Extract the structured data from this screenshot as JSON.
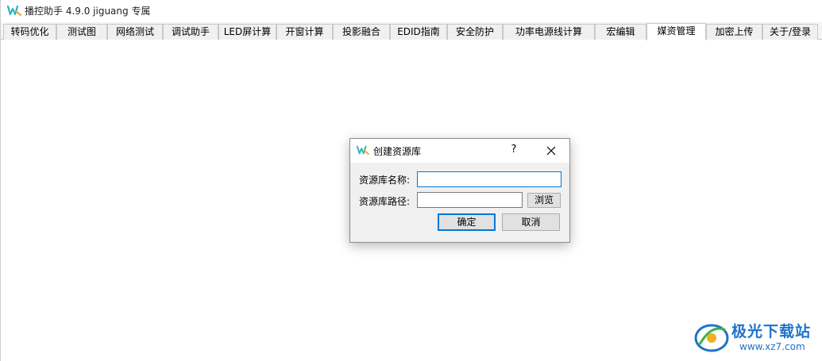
{
  "app": {
    "title": "播控助手 4.9.0  jiguang 专属",
    "logo_icon": "app-logo-icon",
    "accent_color": "#2bb3c0"
  },
  "tabs": [
    {
      "label": "转码优化",
      "active": false
    },
    {
      "label": "测试图",
      "active": false
    },
    {
      "label": "网络测试",
      "active": false
    },
    {
      "label": "调试助手",
      "active": false
    },
    {
      "label": "LED屏计算",
      "active": false
    },
    {
      "label": "开窗计算",
      "active": false
    },
    {
      "label": "投影融合",
      "active": false
    },
    {
      "label": "EDID指南",
      "active": false
    },
    {
      "label": "安全防护",
      "active": false
    },
    {
      "label": "功率电源线计算",
      "active": false
    },
    {
      "label": "宏编辑",
      "active": false
    },
    {
      "label": "媒资管理",
      "active": true
    },
    {
      "label": "加密上传",
      "active": false
    },
    {
      "label": "关于/登录",
      "active": false
    }
  ],
  "dialog": {
    "title": "创建资源库",
    "help_label": "?",
    "close_icon": "close-icon",
    "name_label": "资源库名称:",
    "name_value": "",
    "path_label": "资源库路径:",
    "path_value": "",
    "browse_label": "浏览",
    "ok_label": "确定",
    "cancel_label": "取消",
    "focus_color": "#0078d7"
  },
  "watermark": {
    "name": "极光下载站",
    "url": "www.xz7.com"
  }
}
